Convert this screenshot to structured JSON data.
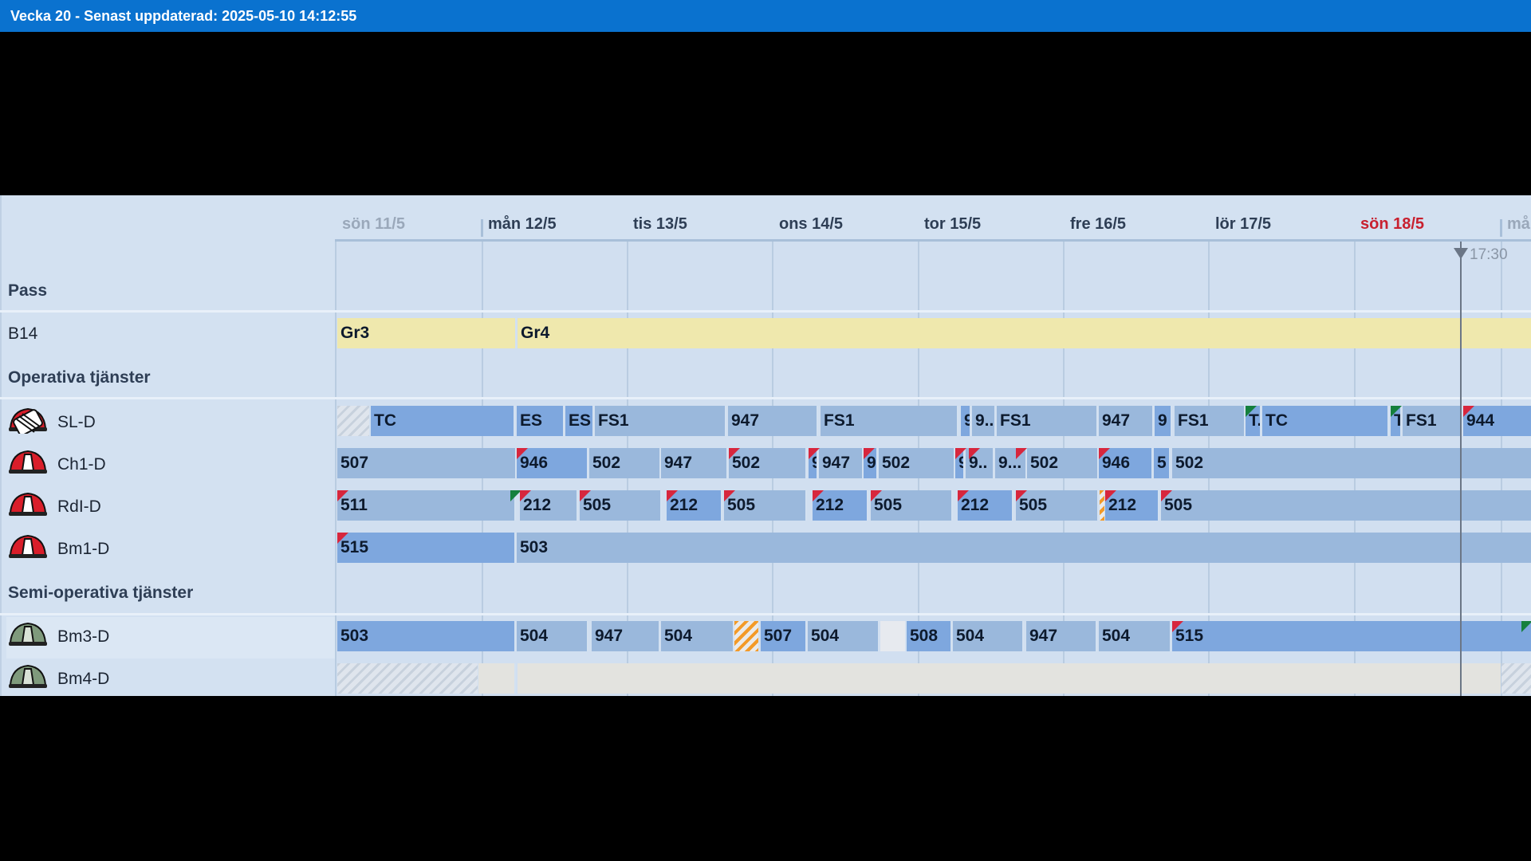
{
  "window": {
    "title": "Vecka 20 - Senast uppdaterad: 2025-05-10 14:12:55"
  },
  "days": [
    "sön 11/5",
    "mån 12/5",
    "tis 13/5",
    "ons 14/5",
    "tor 15/5",
    "fre 16/5",
    "lör 17/5",
    "sön 18/5",
    "må"
  ],
  "now_time": "17:30",
  "sections": {
    "pass": "Pass",
    "operative": "Operativa tjänster",
    "semi": "Semi-operativa tjänster"
  },
  "rows": {
    "b14": {
      "label": "B14",
      "chips": [
        "Gr3",
        "Gr4"
      ]
    },
    "sl": {
      "label": "SL-D",
      "chips": [
        "",
        "TC",
        "ES",
        "ES",
        "FS1",
        "947",
        "FS1",
        "9",
        "9..",
        "FS1",
        "947",
        "9",
        "FS1",
        "T.",
        "TC",
        "T",
        "FS1",
        "944"
      ]
    },
    "ch1": {
      "label": "Ch1-D",
      "chips": [
        "507",
        "946",
        "502",
        "947",
        "502",
        "9",
        "947",
        "9",
        "502",
        "9",
        "9..",
        "9...",
        "502",
        "946",
        "5",
        "502"
      ]
    },
    "rdl": {
      "label": "RdI-D",
      "chips": [
        "511",
        "212",
        "505",
        "212",
        "505",
        "212",
        "505",
        "212",
        "505",
        "",
        "212",
        "505"
      ]
    },
    "bm1": {
      "label": "Bm1-D",
      "chips": [
        "515",
        "503"
      ]
    },
    "bm3": {
      "label": "Bm3-D",
      "chips": [
        "503",
        "504",
        "947",
        "504",
        "",
        "507",
        "504",
        "",
        "508",
        "504",
        "947",
        "504",
        "515"
      ]
    },
    "bm4": {
      "label": "Bm4-D",
      "chips": [
        "",
        "",
        "",
        ""
      ]
    }
  },
  "colors": {
    "titlebar": "#0a72cf",
    "chip_light": "#9ab8dc",
    "chip_dark": "#7ea7de",
    "chip_pass": "#efe8ad",
    "flag_red": "#d7263d",
    "flag_green": "#15803d",
    "sunday": "#c8202f"
  },
  "icons": {
    "sl": "fire-helmet-ladder-icon",
    "operative": "red-fire-helmet-icon",
    "semi": "gray-fire-helmet-icon"
  }
}
